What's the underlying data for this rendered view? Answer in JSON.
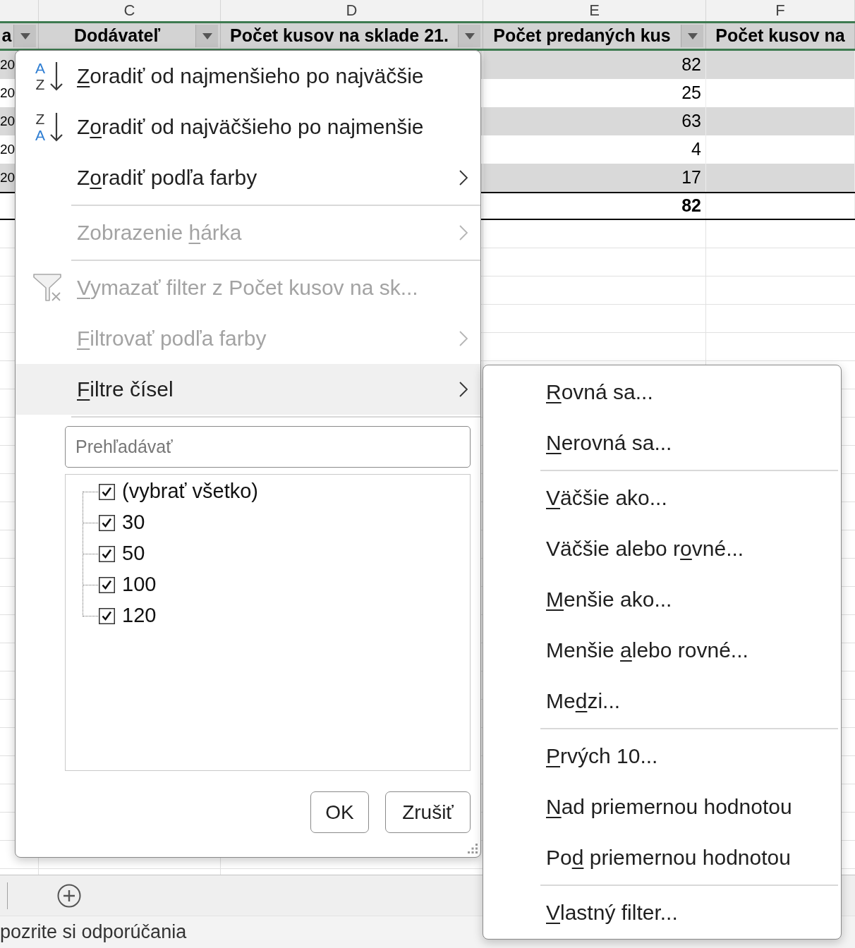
{
  "sheet": {
    "columns": [
      {
        "heading": "a",
        "filter_button": true
      },
      {
        "letter": "C",
        "heading": "Dodávateľ",
        "filter_button": true
      },
      {
        "letter": "D",
        "heading": "Počet kusov na sklade 21.",
        "filter_button": true
      },
      {
        "letter": "E",
        "heading": "Počet predaných kus",
        "filter_button": true
      },
      {
        "letter": "F",
        "heading": "Počet kusov na"
      }
    ],
    "rows": [
      {
        "banded": true,
        "column_1": "20",
        "column_4": "82"
      },
      {
        "banded": false,
        "column_1": "20",
        "column_4": "25"
      },
      {
        "banded": true,
        "column_1": "20",
        "column_4": "63"
      },
      {
        "banded": false,
        "column_1": "20",
        "column_4": "4"
      },
      {
        "banded": true,
        "column_1": "20",
        "column_4": "17"
      }
    ],
    "total_row": {
      "column_4": "82"
    }
  },
  "filter_menu": {
    "items": [
      {
        "kind": "sort_ascending",
        "icon_letters": [
          "A",
          "Z"
        ],
        "label": {
          "key": "Z",
          "after": "oradiť od najmenšieho po najväčšie"
        },
        "disabled": false,
        "highlighted": false
      },
      {
        "kind": "sort_descending",
        "icon_letters": [
          "Z",
          "A"
        ],
        "label": {
          "before": "Z",
          "key": "o",
          "after": "radiť od najväčšieho po najmenšie"
        },
        "disabled": false,
        "highlighted": false
      },
      {
        "kind": "submenu",
        "label": {
          "before": "Z",
          "key": "o",
          "after": "radiť podľa farby"
        },
        "disabled": false,
        "highlighted": false
      },
      {
        "kind": "separator"
      },
      {
        "kind": "submenu",
        "label": {
          "before": "Zobrazenie ",
          "key": "h",
          "after": "árka"
        },
        "disabled": true,
        "highlighted": false
      },
      {
        "kind": "separator"
      },
      {
        "kind": "clear_filter",
        "label": {
          "key": "V",
          "after": "ymazať filter z Počet kusov na sk..."
        },
        "disabled": true,
        "highlighted": false
      },
      {
        "kind": "submenu",
        "label": {
          "key": "F",
          "after": "iltrovať podľa farby"
        },
        "disabled": true,
        "highlighted": false
      },
      {
        "kind": "submenu",
        "label": {
          "key": "F",
          "after": "iltre čísel"
        },
        "disabled": false,
        "highlighted": true
      },
      {
        "kind": "separator"
      }
    ],
    "search": {
      "placeholder": "Prehľadávať"
    },
    "values": [
      {
        "label": "(vybrať všetko)",
        "checked": true
      },
      {
        "label": "30",
        "checked": true
      },
      {
        "label": "50",
        "checked": true
      },
      {
        "label": "100",
        "checked": true
      },
      {
        "label": "120",
        "checked": true
      }
    ],
    "buttons": [
      "OK",
      "Zrušiť"
    ]
  },
  "number_filters_submenu": {
    "items": [
      {
        "kind": "command",
        "label": {
          "key": "R",
          "after": "ovná sa..."
        }
      },
      {
        "kind": "command",
        "label": {
          "key": "N",
          "after": "erovná sa..."
        }
      },
      {
        "kind": "separator"
      },
      {
        "kind": "command",
        "label": {
          "key": "V",
          "after": "äčšie ako..."
        }
      },
      {
        "kind": "command",
        "label": {
          "before": "Väčšie alebo r",
          "key": "o",
          "after": "vné..."
        }
      },
      {
        "kind": "command",
        "label": {
          "key": "M",
          "after": "enšie ako..."
        }
      },
      {
        "kind": "command",
        "label": {
          "before": "Menšie ",
          "key": "a",
          "after": "lebo rovné..."
        }
      },
      {
        "kind": "command",
        "label": {
          "before": "Me",
          "key": "d",
          "after": "zi..."
        }
      },
      {
        "kind": "separator"
      },
      {
        "kind": "command",
        "label": {
          "key": "P",
          "after": "rvých 10..."
        }
      },
      {
        "kind": "command",
        "label": {
          "key": "N",
          "after": "ad priemernou hodnotou"
        }
      },
      {
        "kind": "command",
        "label": {
          "before": "Po",
          "key": "d",
          "after": " priemernou hodnotou"
        }
      },
      {
        "kind": "separator"
      },
      {
        "kind": "command",
        "label": {
          "key": "V",
          "after": "lastný filter..."
        }
      }
    ]
  },
  "status_bar": {
    "text": "pozrite si odporúčania"
  }
}
